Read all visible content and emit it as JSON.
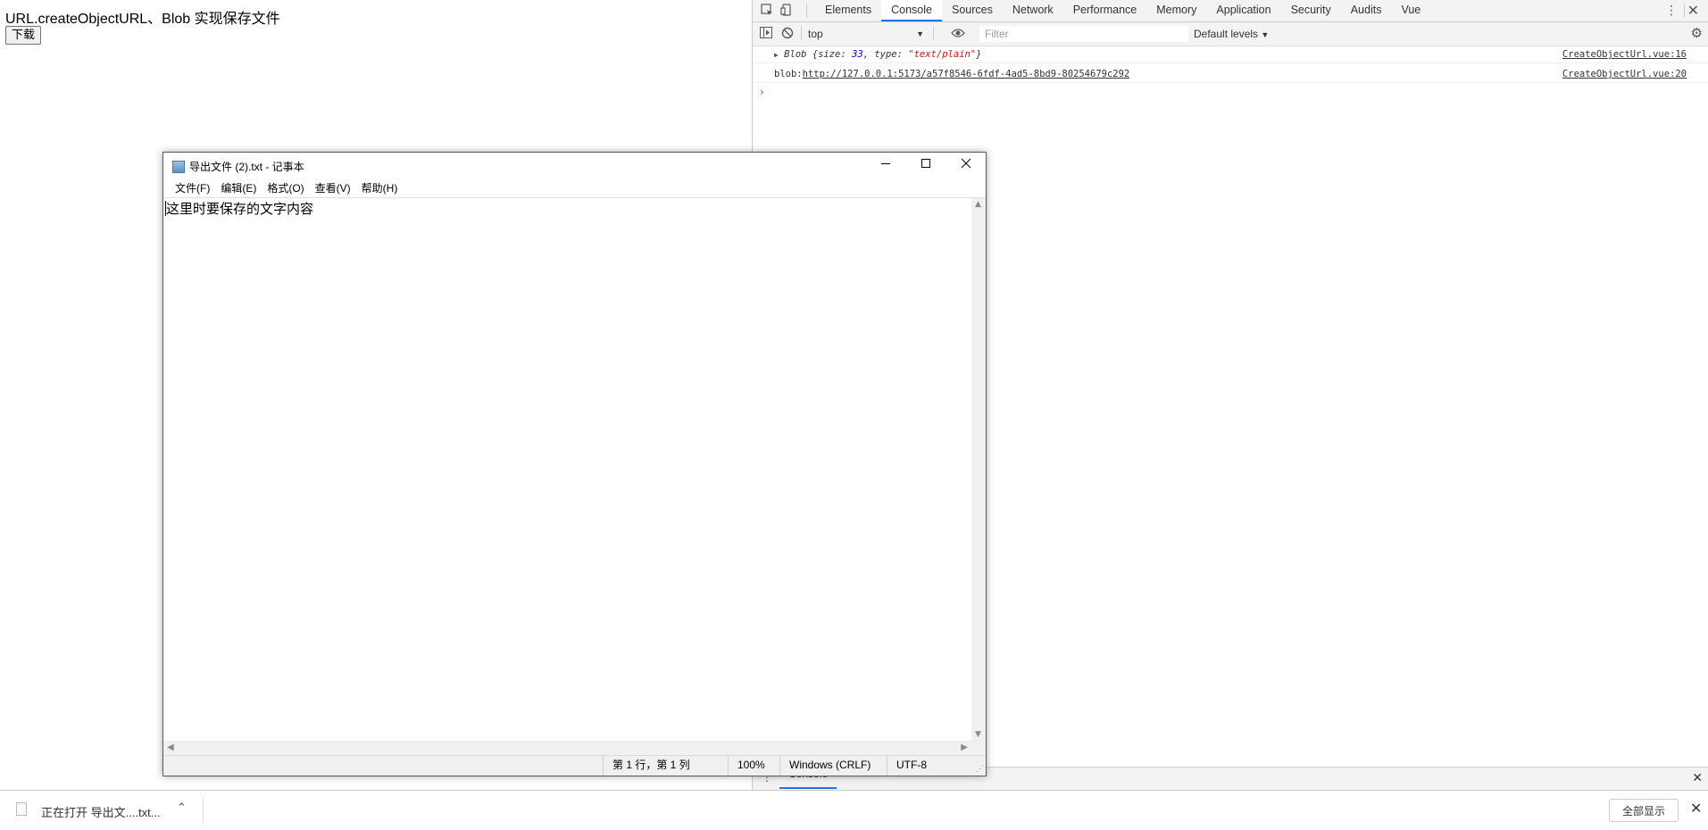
{
  "page": {
    "title": "URL.createObjectURL、Blob 实现保存文件",
    "download_button": "下载"
  },
  "devtools": {
    "tabs": [
      "Elements",
      "Console",
      "Sources",
      "Network",
      "Performance",
      "Memory",
      "Application",
      "Security",
      "Audits",
      "Vue"
    ],
    "active_tab": "Console",
    "context": "top",
    "filter_placeholder": "Filter",
    "levels": "Default levels",
    "console": [
      {
        "prefix": "▶",
        "label": "Blob",
        "open": " {size: ",
        "size": "33",
        "mid": ", type: ",
        "type": "\"text/plain\"",
        "close": "}",
        "source": "CreateObjectUrl.vue:16"
      },
      {
        "prefix": "blob:",
        "url": "http://127.0.0.1:5173/a57f8546-6fdf-4ad5-8bd9-80254679c292",
        "source": "CreateObjectUrl.vue:20"
      }
    ],
    "prompt": "›",
    "drawer_tab": "Console"
  },
  "notepad": {
    "title": "导出文件 (2).txt - 记事本",
    "menu": [
      "文件(F)",
      "编辑(E)",
      "格式(O)",
      "查看(V)",
      "帮助(H)"
    ],
    "content": "这里时要保存的文字内容",
    "status": {
      "position": "第 1 行，第 1 列",
      "zoom": "100%",
      "line_ending": "Windows (CRLF)",
      "encoding": "UTF-8"
    }
  },
  "download_bar": {
    "item_label": "正在打开 导出文....txt...",
    "show_all": "全部显示"
  },
  "icons": {
    "inspect": "inspect-icon",
    "device": "device-toggle-icon",
    "sidebar": "sidebar-toggle-icon",
    "clear": "clear-console-icon",
    "eye": "live-expression-icon",
    "settings": "gear-icon"
  }
}
